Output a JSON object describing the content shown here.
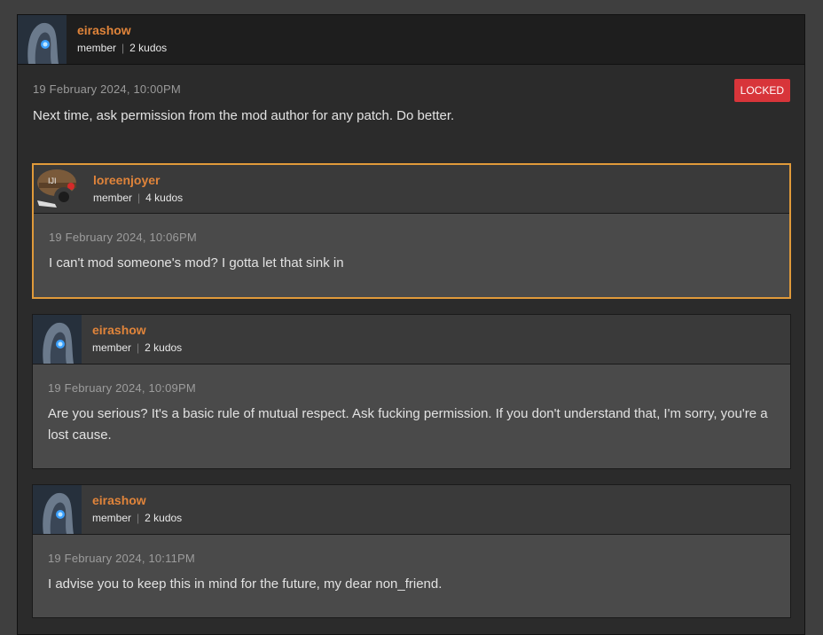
{
  "main_post": {
    "username": "eirashow",
    "role": "member",
    "kudos": "2 kudos",
    "date": "19 February 2024, 10:00PM",
    "badge": "LOCKED",
    "text": "Next time, ask permission from the mod author for any patch. Do better."
  },
  "replies": [
    {
      "username": "loreenjoyer",
      "role": "member",
      "kudos": "4 kudos",
      "date": "19 February 2024, 10:06PM",
      "text": "I can't mod someone's mod? I gotta let that sink in"
    },
    {
      "username": "eirashow",
      "role": "member",
      "kudos": "2 kudos",
      "date": "19 February 2024, 10:09PM",
      "text": "Are you serious? It's a basic rule of mutual respect. Ask fucking permission. If you don't understand that, I'm sorry, you're a lost cause."
    },
    {
      "username": "eirashow",
      "role": "member",
      "kudos": "2 kudos",
      "date": "19 February 2024, 10:11PM",
      "text": "I advise you to keep this in mind for the future, my dear non_friend."
    }
  ],
  "colors": {
    "username": "#e0843a",
    "highlight_border": "#e09a3a",
    "locked_badge": "#d8353a"
  }
}
